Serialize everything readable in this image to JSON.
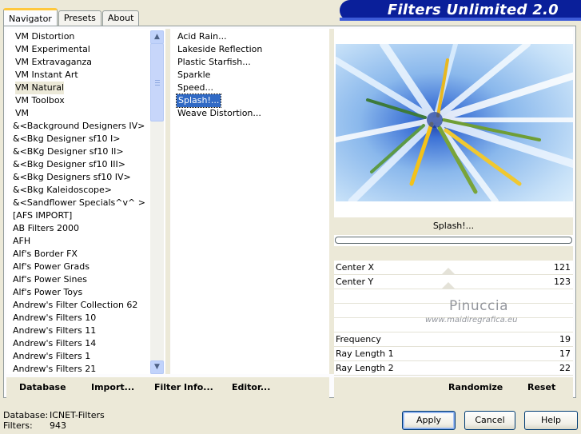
{
  "tabs": [
    "Navigator",
    "Presets",
    "About"
  ],
  "banner_title": "Filters Unlimited 2.0",
  "categories": [
    "VM Distortion",
    "VM Experimental",
    "VM Extravaganza",
    "VM Instant Art",
    "VM Natural",
    "VM Toolbox",
    "VM",
    "&<Background Designers IV>",
    "&<Bkg Designer sf10 I>",
    "&<BKg Designer sf10 II>",
    "&<Bkg Designer sf10 III>",
    "&<Bkg Designers sf10 IV>",
    "&<Bkg Kaleidoscope>",
    "&<Sandflower Specials^v^ >",
    "[AFS IMPORT]",
    "AB Filters 2000",
    "AFH",
    "Alf's Border FX",
    "Alf's Power Grads",
    "Alf's Power Sines",
    "Alf's Power Toys",
    "Andrew's Filter Collection 62",
    "Andrew's Filters 10",
    "Andrew's Filters 11",
    "Andrew's Filters 14",
    "Andrew's Filters 1",
    "Andrew's Filters 21"
  ],
  "selected_category": "VM Natural",
  "filters": [
    "Acid Rain...",
    "Lakeside Reflection",
    "Plastic Starfish...",
    "Sparkle",
    "Speed...",
    "Splash!...",
    "Weave Distortion..."
  ],
  "selected_filter": "Splash!...",
  "preview_filter_name": "Splash!...",
  "params": [
    {
      "label": "Center X",
      "value": "121"
    },
    {
      "label": "Center Y",
      "value": "123"
    },
    {
      "label": "Frequency",
      "value": "19"
    },
    {
      "label": "Ray Length 1",
      "value": "17"
    },
    {
      "label": "Ray Length 2",
      "value": "22"
    }
  ],
  "watermark": {
    "line1": "Pinuccia",
    "line2": "www.maidiregrafica.eu"
  },
  "left_buttons": {
    "database": "Database",
    "import": "Import...",
    "filter_info": "Filter Info...",
    "editor": "Editor..."
  },
  "right_buttons": {
    "randomize": "Randomize",
    "reset": "Reset"
  },
  "footer": {
    "database_label": "Database:",
    "database_value": "ICNET-Filters",
    "filters_label": "Filters:",
    "filters_value": "943"
  },
  "dialog_buttons": {
    "apply": "Apply",
    "cancel": "Cancel",
    "help": "Help"
  }
}
